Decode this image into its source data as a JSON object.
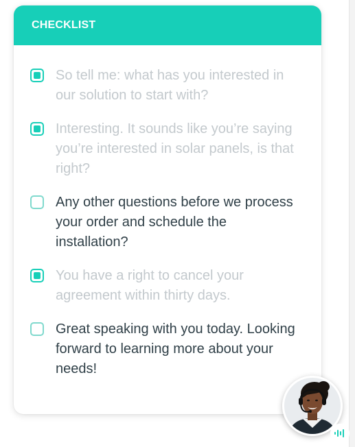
{
  "checklist": {
    "title": "CHECKLIST",
    "accent_color": "#17cfb8",
    "items": [
      {
        "text": "So tell me: what has you interested in our solution to start with?",
        "checked": true
      },
      {
        "text": "Interesting. It sounds like you’re saying you’re interested in solar panels, is that right?",
        "checked": true
      },
      {
        "text": "Any other questions before we process your order and schedule the installation?",
        "checked": false
      },
      {
        "text": "You have a right to cancel your agreement within thirty days.",
        "checked": true
      },
      {
        "text": "Great speaking with you today. Looking forward to learning more about your needs!",
        "checked": false
      }
    ]
  },
  "agent": {
    "avatar_icon": "agent-avatar-headset",
    "status_icon": "audio-waveform-icon"
  }
}
